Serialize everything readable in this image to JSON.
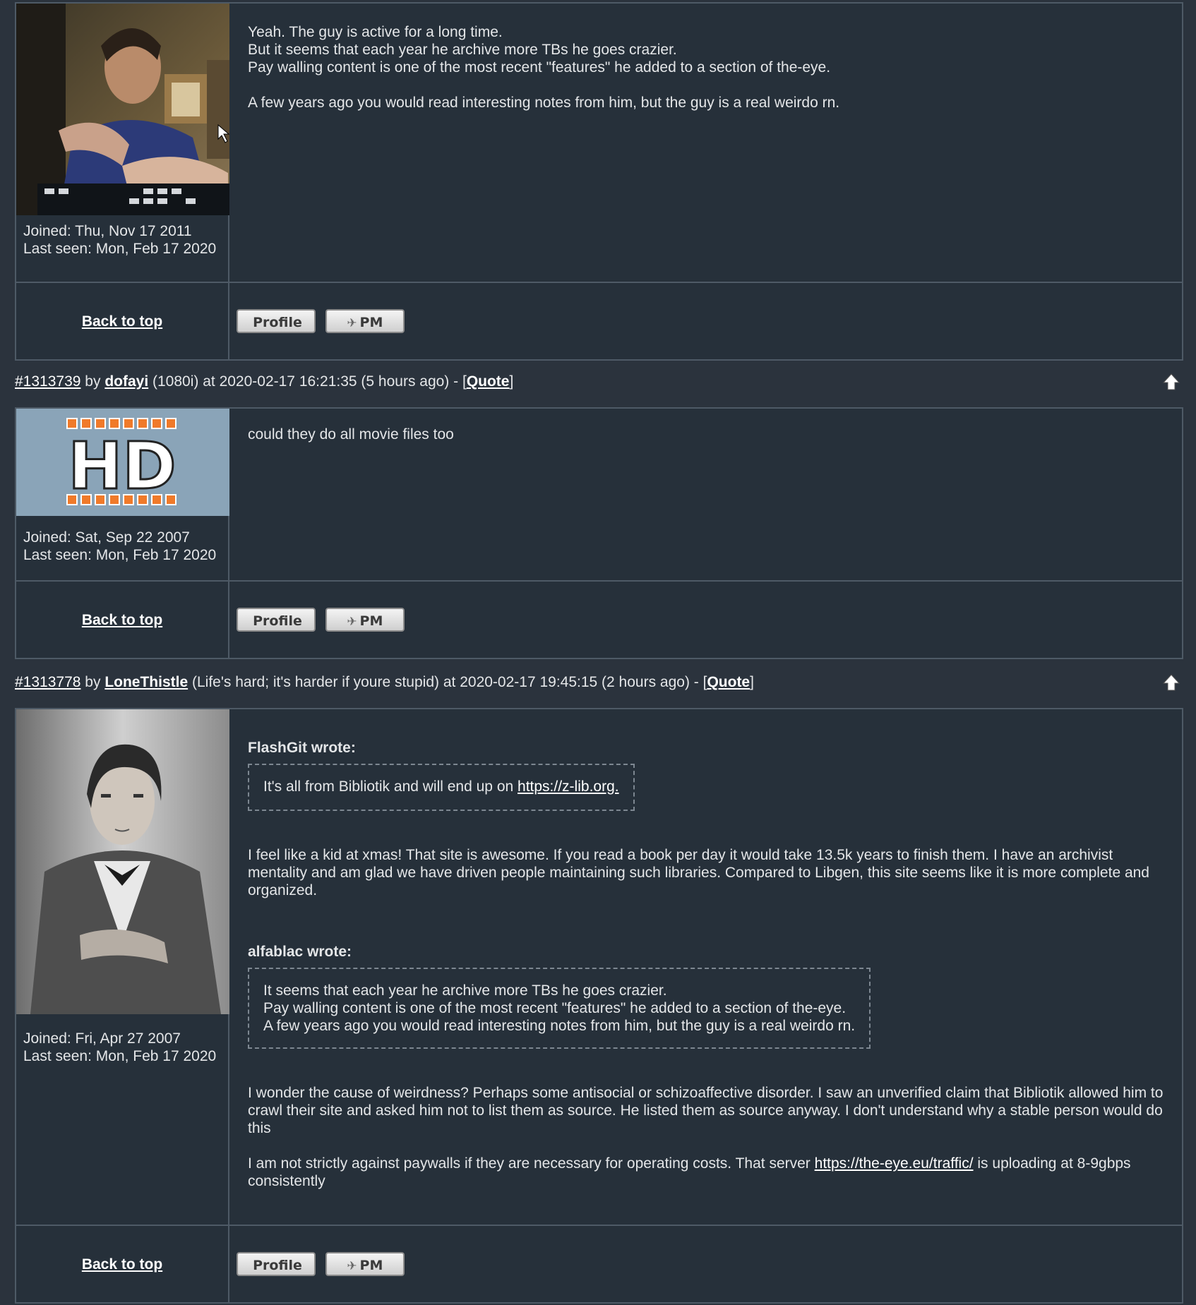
{
  "posts": [
    {
      "joined": "Joined: Thu, Nov 17 2011",
      "last_seen": "Last seen: Mon, Feb 17 2020",
      "body_lines": [
        "Yeah. The guy is active for a long time.",
        "But it seems that each year he archive more TBs he goes crazier.",
        "Pay walling content is one of the most recent \"features\" he added to a section of the-eye."
      ],
      "body_para2": "A few years ago you would read interesting notes from him, but the guy is a real weirdo rn."
    },
    {
      "header": {
        "post_id": "#1313739",
        "by": "by",
        "username": "dofayi",
        "user_title": "(1080i)",
        "at": "at 2020-02-17 16:21:35 (5 hours ago) - [",
        "quote": "Quote",
        "close": "]"
      },
      "avatar_text": "HD",
      "joined": "Joined: Sat, Sep 22 2007",
      "last_seen": "Last seen: Mon, Feb 17 2020",
      "body": "could they do all movie files too"
    },
    {
      "header": {
        "post_id": "#1313778",
        "by": "by",
        "username": "LoneThistle",
        "user_title": "(Life's hard; it's harder if youre stupid)",
        "at": "at 2020-02-17 19:45:15 (2 hours ago) - [",
        "quote": "Quote",
        "close": "]"
      },
      "joined": "Joined: Fri, Apr 27 2007",
      "last_seen": "Last seen: Mon, Feb 17 2020",
      "quote1_author": "FlashGit wrote:",
      "quote1_text": "It's all from Bibliotik and will end up on",
      "quote1_link": "https://z-lib.org.",
      "para1": "I feel like a kid at xmas! That site is awesome. If you read a book per day it would take 13.5k years to finish them. I have an archivist mentality and am glad we have driven people maintaining such libraries. Compared to Libgen, this site seems like it is more complete and organized.",
      "quote2_author": "alfablac wrote:",
      "quote2_lines": [
        "It seems that each year he archive more TBs he goes crazier.",
        "Pay walling content is one of the most recent \"features\" he added to a section of the-eye.",
        "A few years ago you would read interesting notes from him, but the guy is a real weirdo rn."
      ],
      "para2": "I wonder the cause of weirdness? Perhaps some antisocial or schizoaffective disorder. I saw an unverified claim that Bibliotik allowed him to crawl their site and asked him not to list them as source. He listed them as source anyway. I don't understand why a stable person would do this",
      "para3_pre": "I am not strictly against paywalls if they are necessary for operating costs. That server",
      "para3_link": "https://the-eye.eu/traffic/",
      "para3_post": "is uploading at 8-9gbps consistently"
    }
  ],
  "common": {
    "back_to_top": "Back to top",
    "profile_button": "Profile",
    "pm_button": "PM",
    "up_icon": "arrow-up-icon"
  }
}
